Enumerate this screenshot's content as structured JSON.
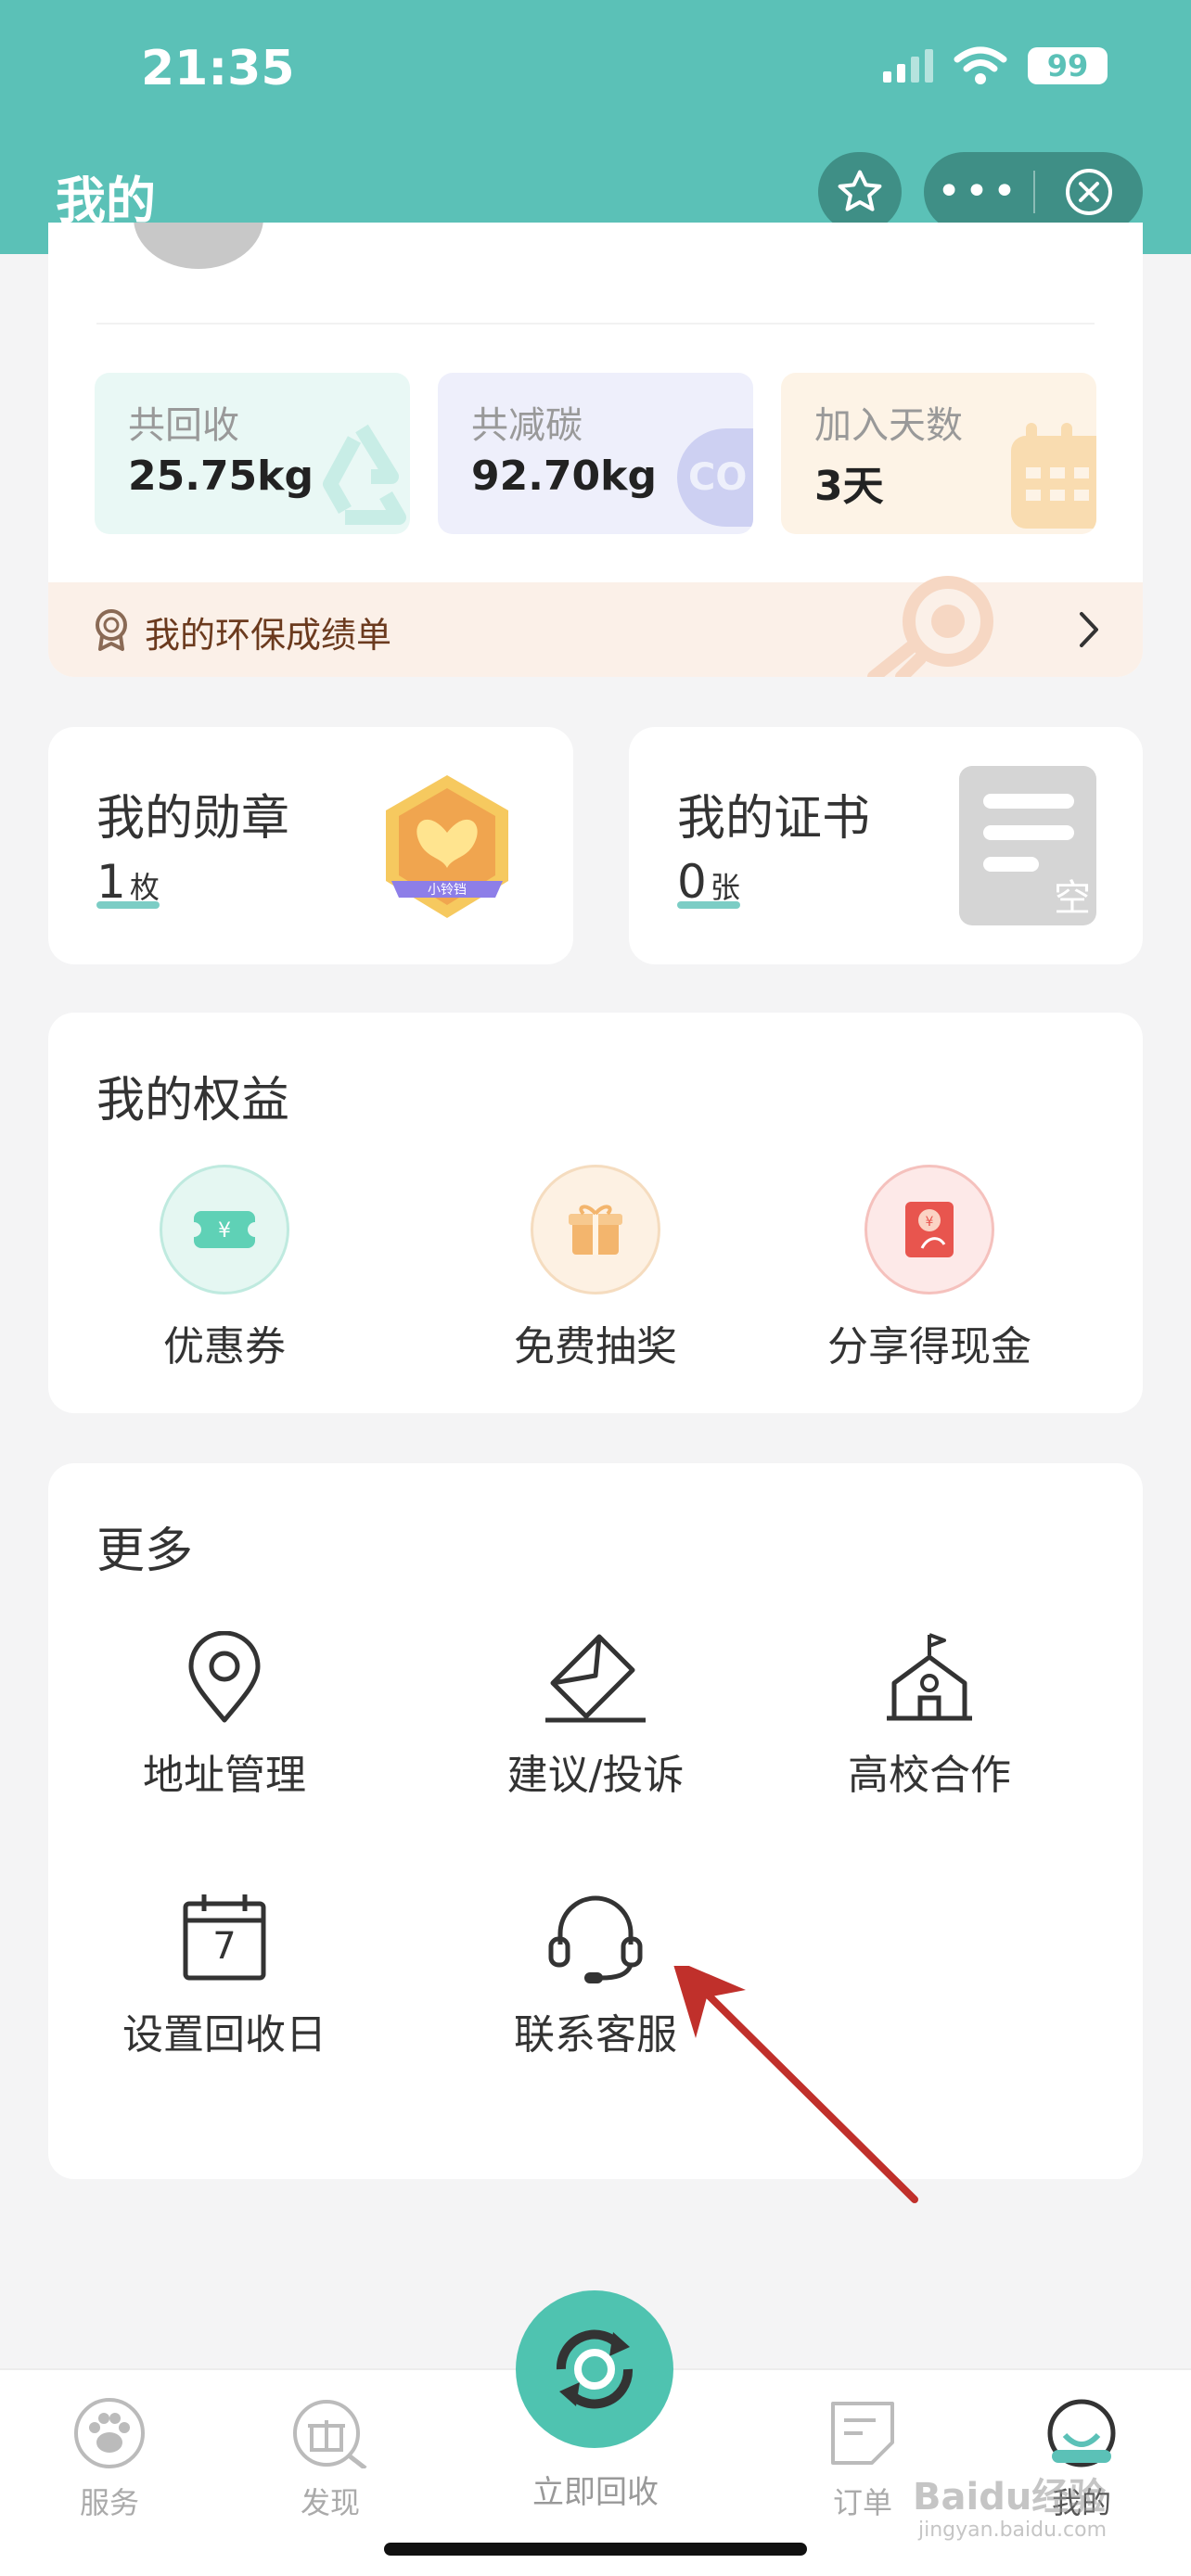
{
  "status_bar": {
    "time": "21:35",
    "battery": "99"
  },
  "nav": {
    "title": "我的",
    "more": "•••"
  },
  "stats": [
    {
      "label": "共回收",
      "value": "25.75kg"
    },
    {
      "label": "共减碳",
      "value": "92.70kg",
      "deco_text": "CO"
    },
    {
      "label": "加入天数",
      "value": "3天"
    }
  ],
  "achievement": {
    "label": "我的环保成绩单"
  },
  "medals": {
    "title": "我的勋章",
    "count": "1",
    "unit": "枚",
    "badge_text": "小铃铛"
  },
  "certificates": {
    "title": "我的证书",
    "count": "0",
    "unit": "张",
    "empty_text": "空"
  },
  "rights": {
    "title": "我的权益",
    "items": [
      {
        "label": "优惠券"
      },
      {
        "label": "免费抽奖"
      },
      {
        "label": "分享得现金"
      }
    ]
  },
  "more": {
    "title": "更多",
    "items": [
      {
        "label": "地址管理"
      },
      {
        "label": "建议/投诉"
      },
      {
        "label": "高校合作"
      },
      {
        "label": "设置回收日",
        "icon_text": "7"
      },
      {
        "label": "联系客服"
      }
    ]
  },
  "tabbar": {
    "tabs": [
      {
        "label": "服务"
      },
      {
        "label": "发现"
      },
      {
        "label": "订单"
      },
      {
        "label": "我的"
      }
    ],
    "center_label": "立即回收"
  },
  "watermark": {
    "text": "Baidu经验",
    "sub": "jingyan.baidu.com"
  }
}
